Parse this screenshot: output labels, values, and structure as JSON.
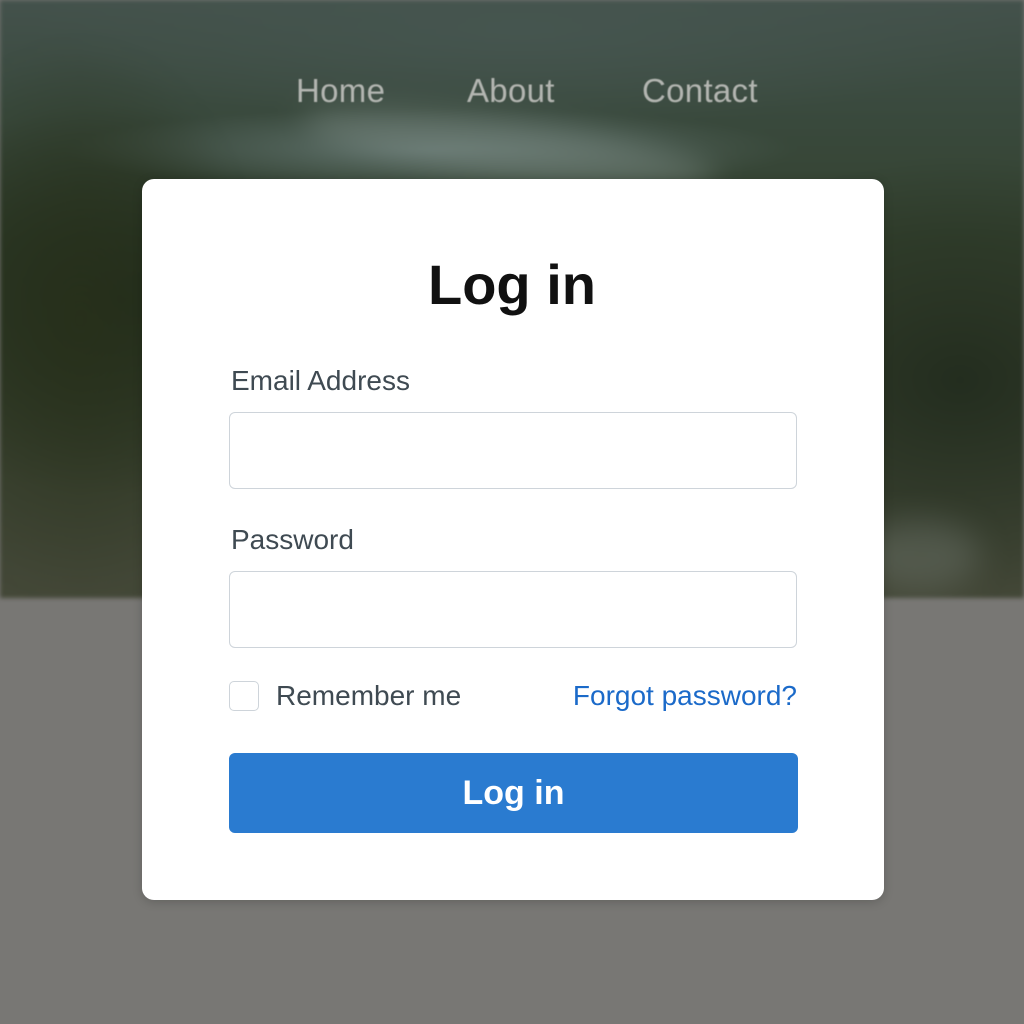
{
  "nav": {
    "items": [
      {
        "label": "Home"
      },
      {
        "label": "About"
      },
      {
        "label": "Contact"
      }
    ]
  },
  "login": {
    "title": "Log in",
    "email_label": "Email Address",
    "email_value": "",
    "password_label": "Password",
    "password_value": "",
    "remember_label": "Remember me",
    "remember_checked": false,
    "forgot_label": "Forgot password?",
    "submit_label": "Log in"
  },
  "colors": {
    "accent": "#2a7bd0",
    "link": "#1b6ac9",
    "card_background": "#ffffff",
    "page_background": "#787774"
  }
}
